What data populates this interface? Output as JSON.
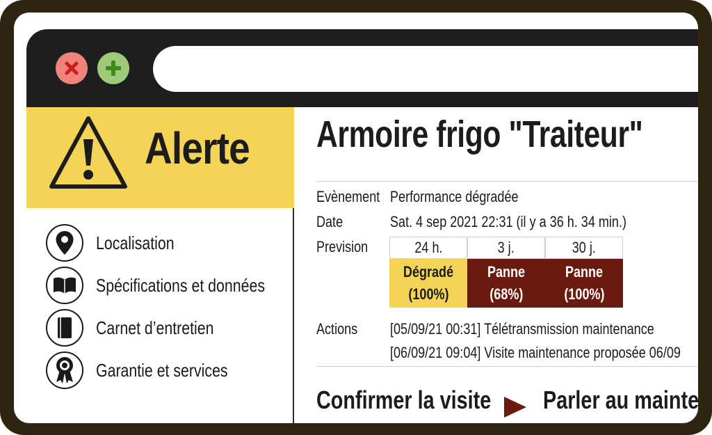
{
  "browser": {
    "close_icon": "close-icon",
    "add_icon": "plus-icon",
    "address_bar_value": ""
  },
  "sidebar": {
    "alert_title": "Alerte",
    "alert_icon": "warning-triangle-icon",
    "items": [
      {
        "label": "Localisation",
        "icon": "map-pin-icon"
      },
      {
        "label": "Spécifications et données",
        "icon": "open-book-icon"
      },
      {
        "label": "Carnet d’entretien",
        "icon": "notebook-icon"
      },
      {
        "label": "Garantie et services",
        "icon": "award-ribbon-icon"
      }
    ]
  },
  "main": {
    "title": "Armoire frigo \"Traiteur\"",
    "event_label": "Evènement",
    "event_value": "Performance dégradée",
    "date_label": "Date",
    "date_value": "Sat. 4 sep 2021 22:31 (il y a 36 h. 34 min.)",
    "forecast_label": "Prevision",
    "forecast": [
      {
        "period": "24 h.",
        "state": "Dégradé",
        "percent": "(100%)"
      },
      {
        "period": "3 j.",
        "state": "Panne",
        "percent": "(68%)"
      },
      {
        "period": "30 j.",
        "state": "Panne",
        "percent": "(100%)"
      }
    ],
    "actions_label": "Actions",
    "actions": [
      "[05/09/21 00:31] Télétransmission maintenance",
      "[06/09/21 09:04] Visite maintenance proposée 06/09"
    ],
    "confirm_button": "Confirmer la visite",
    "contact_button": "Parler au mainter"
  },
  "colors": {
    "alert_yellow": "#f4d457",
    "degraded": "#f4d457",
    "failure": "#6b1a0f",
    "frame": "#2e2510",
    "titlebar": "#1e1e1e"
  }
}
